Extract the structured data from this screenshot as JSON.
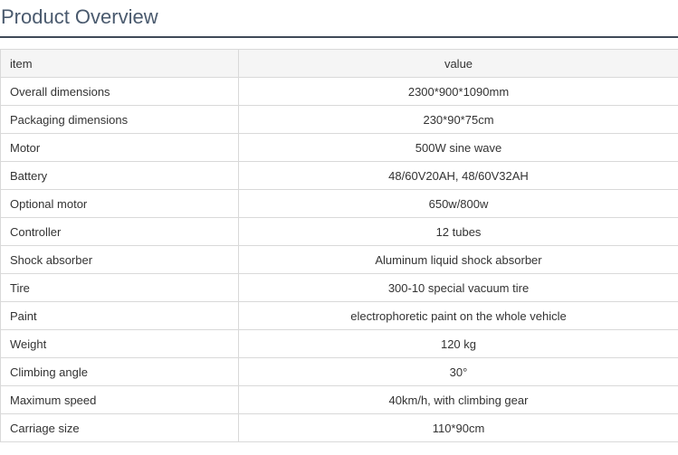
{
  "page": {
    "title": "Product Overview"
  },
  "table": {
    "header": {
      "item": "item",
      "value": "value"
    },
    "rows": [
      {
        "item": "Overall dimensions",
        "value": "2300*900*1090mm"
      },
      {
        "item": "Packaging dimensions",
        "value": "230*90*75cm"
      },
      {
        "item": "Motor",
        "value": "500W sine wave"
      },
      {
        "item": "Battery",
        "value": "48/60V20AH, 48/60V32AH"
      },
      {
        "item": "Optional motor",
        "value": "650w/800w"
      },
      {
        "item": "Controller",
        "value": "12 tubes"
      },
      {
        "item": "Shock absorber",
        "value": "Aluminum liquid shock absorber"
      },
      {
        "item": "Tire",
        "value": "300-10 special vacuum tire"
      },
      {
        "item": "Paint",
        "value": "electrophoretic paint on the whole vehicle"
      },
      {
        "item": "Weight",
        "value": "120 kg"
      },
      {
        "item": "Climbing angle",
        "value": "30°"
      },
      {
        "item": "Maximum speed",
        "value": "40km/h, with climbing gear"
      },
      {
        "item": "Carriage size",
        "value": "110*90cm"
      }
    ]
  },
  "colors": {
    "title_text": "#4a5a6e",
    "title_rule": "#3f4a58",
    "header_bg": "#f5f5f5",
    "border": "#d9d9d9"
  }
}
